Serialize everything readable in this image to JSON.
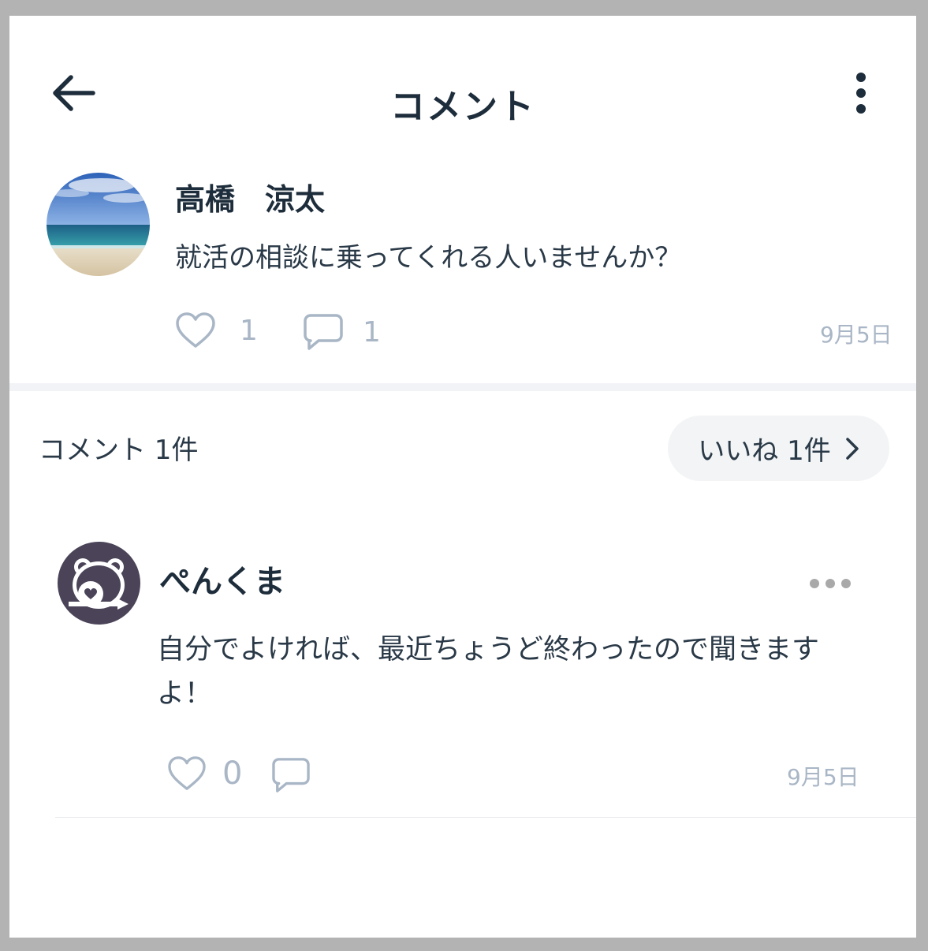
{
  "header": {
    "title": "コメント",
    "back_icon": "arrow-left-icon",
    "menu_icon": "kebab-menu-icon"
  },
  "post": {
    "author": "高橋　涼太",
    "body": "就活の相談に乗ってくれる人いませんか？",
    "likes": "1",
    "comments": "1",
    "date": "9月5日",
    "avatar": "beach-photo"
  },
  "comments_section": {
    "count_label": "コメント 1件",
    "likes_pill_label": "いいね 1件"
  },
  "comment": {
    "author": "ぺんくま",
    "body": "自分でよければ、最近ちょうど終わったので聞きますよ！",
    "likes": "0",
    "date": "9月5日",
    "avatar": "bear-icon"
  },
  "colors": {
    "text": "#1e2d3b",
    "muted": "#a9b6c6",
    "pill_bg": "#f2f4f6",
    "avatar_bg": "#4b4358"
  }
}
